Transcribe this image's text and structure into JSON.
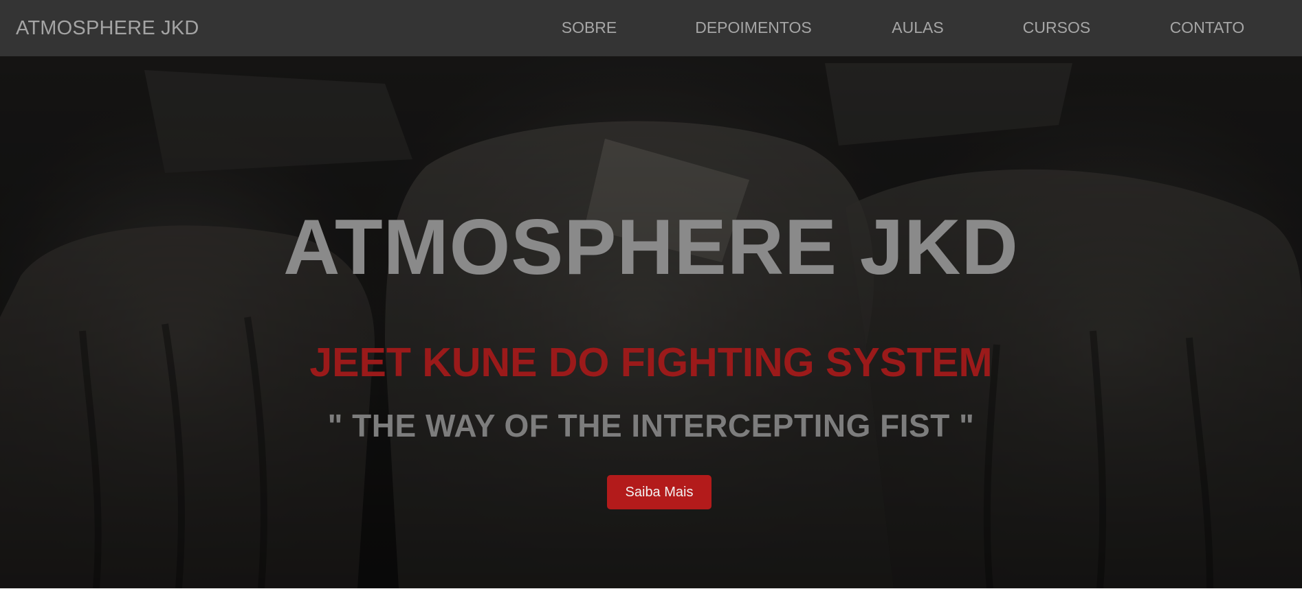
{
  "navbar": {
    "brand": "ATMOSPHERE JKD",
    "links": [
      {
        "label": "SOBRE"
      },
      {
        "label": "DEPOIMENTOS"
      },
      {
        "label": "AULAS"
      },
      {
        "label": "CURSOS"
      },
      {
        "label": "CONTATO"
      }
    ]
  },
  "hero": {
    "background_image": "dark-boxing-gloves-photo",
    "title": "ATMOSPHERE JKD",
    "subtitle": "JEET KUNE DO FIGHTING SYSTEM",
    "quote": "\" THE WAY OF THE INTERCEPTING FIST \"",
    "cta_label": "Saiba Mais"
  },
  "colors": {
    "navbar_bg": "#343434",
    "nav_text": "#a6a6a6",
    "accent_red": "#b31b1b",
    "subtitle_red": "#9b1a1a",
    "title_gray": "#8a8a8a"
  }
}
